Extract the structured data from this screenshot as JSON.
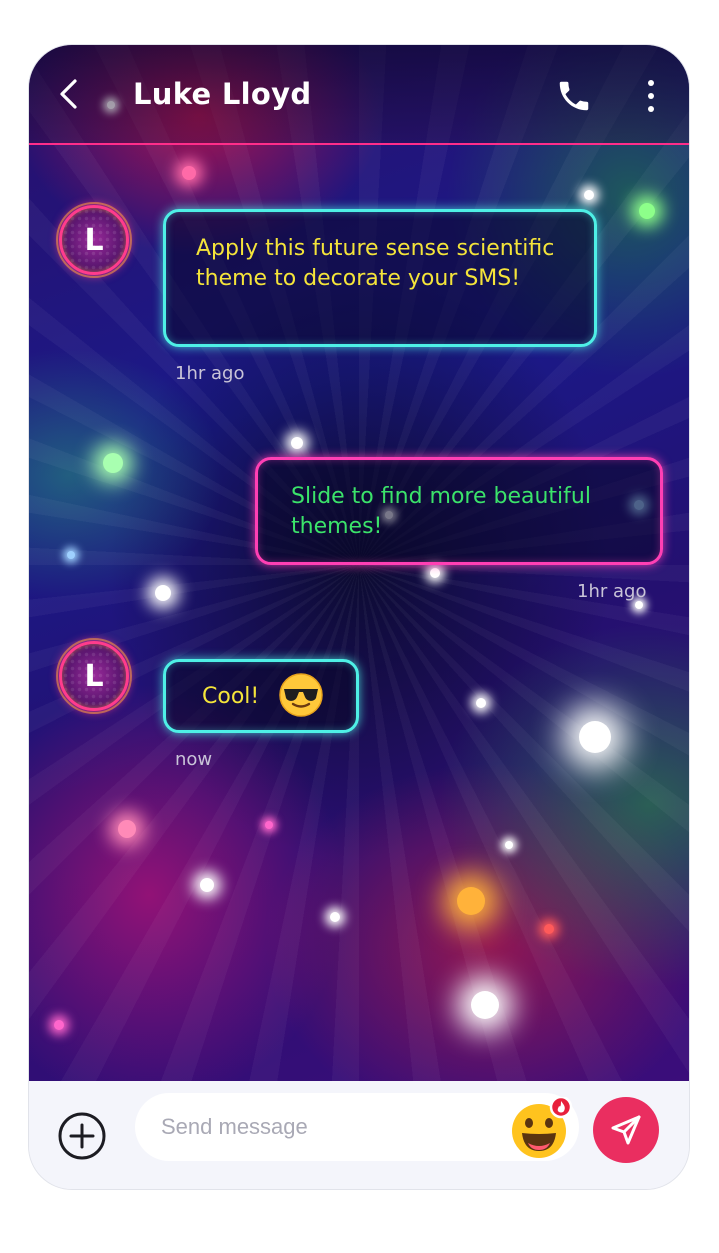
{
  "header": {
    "contact_name": "Luke Lloyd",
    "back_icon": "chevron-left-icon",
    "call_icon": "phone-icon",
    "more_icon": "more-vertical-icon"
  },
  "messages": [
    {
      "direction": "incoming",
      "avatar_letter": "L",
      "text": "Apply this future sense scientific theme to decorate your SMS!",
      "time": "1hr ago"
    },
    {
      "direction": "outgoing",
      "text": "Slide to find more beautiful themes!",
      "time": "1hr ago"
    },
    {
      "direction": "incoming",
      "avatar_letter": "L",
      "text": "Cool!",
      "emoji": "smiling-face-with-sunglasses",
      "time": "now"
    }
  ],
  "composer": {
    "placeholder": "Send message",
    "add_icon": "plus-circle-icon",
    "emoji_icon": "grinning-face-icon",
    "send_icon": "send-icon"
  },
  "colors": {
    "header_line": "#ff2d8a",
    "incoming_border": "#4ef0e6",
    "outgoing_border": "#ff3fb4",
    "incoming_text": "#f4e43a",
    "outgoing_text": "#3be36a",
    "send_button": "#ea2e60"
  }
}
